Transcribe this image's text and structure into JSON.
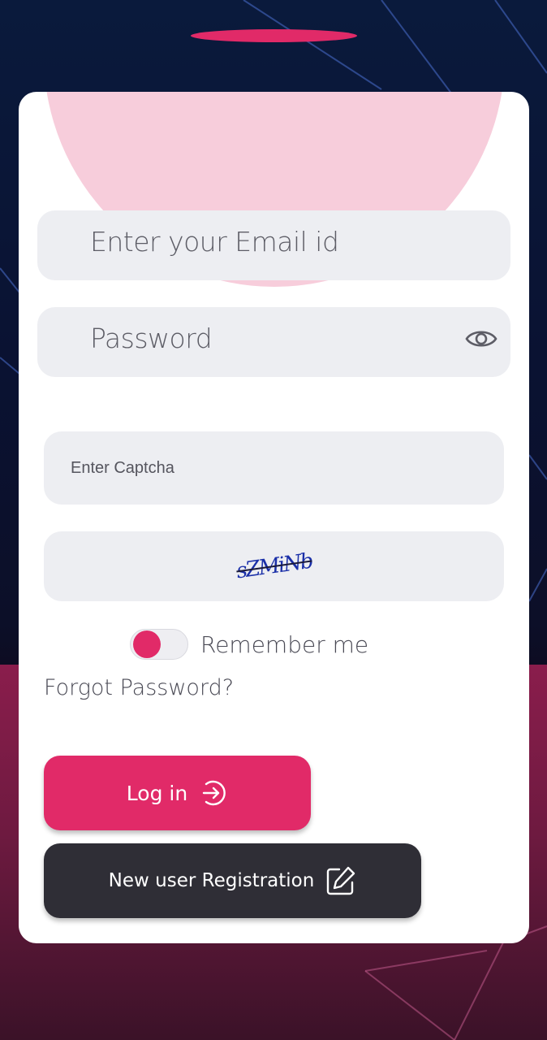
{
  "form": {
    "email_placeholder": "Enter your Email id",
    "password_placeholder": "Password",
    "captcha_placeholder": "Enter Captcha",
    "captcha_code": "sZMiNb",
    "remember_label": "Remember me",
    "remember_on": true,
    "forgot_label": "Forgot Password?",
    "login_label": "Log in",
    "register_label": "New user Registration"
  },
  "icons": {
    "eye": "eye-icon",
    "login": "arrow-right-circle-icon",
    "register": "edit-icon"
  },
  "colors": {
    "accent": "#e12a68",
    "dark_button": "#2f2e36",
    "field_bg": "#edeef2",
    "pink_decor": "#f7cddb"
  }
}
